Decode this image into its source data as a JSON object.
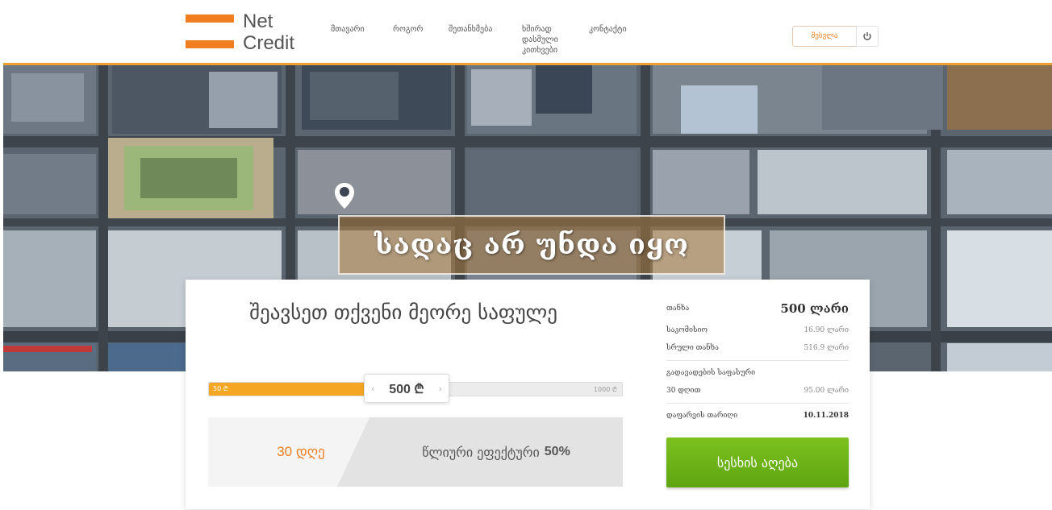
{
  "brand": {
    "logo_line1": "Net",
    "logo_line2": "Credit",
    "accent_color": "#f07d1e"
  },
  "nav": {
    "items": [
      {
        "label": "მთავარი"
      },
      {
        "label": "როგორ"
      },
      {
        "label": "შეთანხმება"
      },
      {
        "label": "ხშირად დასმული კითხვები"
      },
      {
        "label": "კონტაქტი"
      }
    ],
    "login_label": "შესვლა",
    "power_icon": "power-icon"
  },
  "hero": {
    "title": "სადაც არ უნდა იყო",
    "pin_icon": "location-pin-icon"
  },
  "form": {
    "title": "შეავსეთ თქვენი მეორე საფულე",
    "slider": {
      "min_label": "50 ₾",
      "max_label": "1000 ₾",
      "value": "500 ₾",
      "value_fraction": 0.47
    },
    "period": "30 დღე",
    "annual_label": "წლიური ეფექტური",
    "annual_value": "50%"
  },
  "summary": {
    "amount_label": "თანხა",
    "amount_value": "500 ლარი",
    "commission_label": "საკომისიო",
    "commission_value": "16.90 ლარი",
    "total_label": "სრული თანხა",
    "total_value": "516.9 ლარი",
    "extension_label": "გადავადების საფასური",
    "extension_days": "30 დღით",
    "extension_value": "95.00 ლარი",
    "date_label": "დაფარვის თარიღი",
    "date_value": "10.11.2018"
  },
  "submit_label": "სესხის აღება"
}
